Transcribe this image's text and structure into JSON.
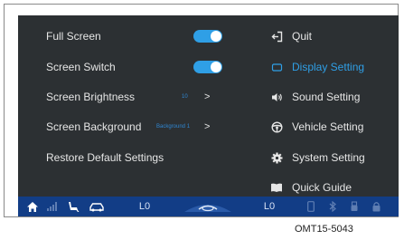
{
  "settings": {
    "full_screen": {
      "label": "Full Screen",
      "enabled": true
    },
    "screen_switch": {
      "label": "Screen Switch",
      "enabled": true
    },
    "screen_brightness": {
      "label": "Screen Brightness",
      "value": "10"
    },
    "screen_background": {
      "label": "Screen Background",
      "value": "Background 1"
    },
    "restore_defaults": {
      "label": "Restore Default Settings"
    }
  },
  "menu": {
    "items": [
      {
        "label": "Quit",
        "icon": "exit-icon",
        "active": false
      },
      {
        "label": "Display Setting",
        "icon": "display-icon",
        "active": true
      },
      {
        "label": "Sound Setting",
        "icon": "speaker-icon",
        "active": false
      },
      {
        "label": "Vehicle Setting",
        "icon": "steering-wheel-icon",
        "active": false
      },
      {
        "label": "System Setting",
        "icon": "gear-icon",
        "active": false
      },
      {
        "label": "Quick Guide",
        "icon": "book-icon",
        "active": false
      }
    ]
  },
  "bottom_bar": {
    "left_level": "L0",
    "right_level": "L0"
  },
  "caption": "OMT15-5043",
  "colors": {
    "accent": "#2f9fe6",
    "panel_bg": "#2c3033",
    "bottom_bar_bg": "#123d86"
  },
  "chevron": ">"
}
